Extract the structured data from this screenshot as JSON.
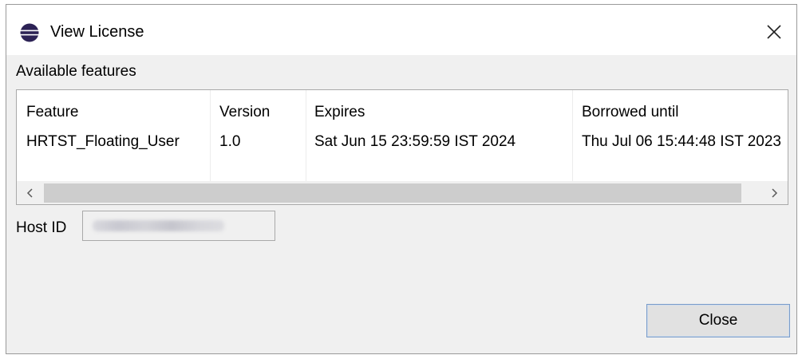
{
  "window": {
    "title": "View License",
    "icon": "eclipse-icon",
    "close_icon": "close-icon"
  },
  "features": {
    "section_label": "Available features",
    "columns": [
      "Feature",
      "Version",
      "Expires",
      "Borrowed until"
    ],
    "rows": [
      {
        "feature": "HRTST_Floating_User",
        "version": "1.0",
        "expires": "Sat Jun 15 23:59:59 IST 2024",
        "borrowed_until": "Thu Jul 06 15:44:48 IST 2023"
      }
    ],
    "scrollbar": {
      "left_arrow": "‹",
      "right_arrow": "›"
    }
  },
  "host": {
    "label": "Host ID",
    "value": ""
  },
  "buttons": {
    "close_label": "Close"
  },
  "colors": {
    "window_bg": "#f0f0f0",
    "button_border": "#7a9cc9",
    "eclipse_purple": "#2c2255",
    "eclipse_orange": "#f7941e"
  }
}
